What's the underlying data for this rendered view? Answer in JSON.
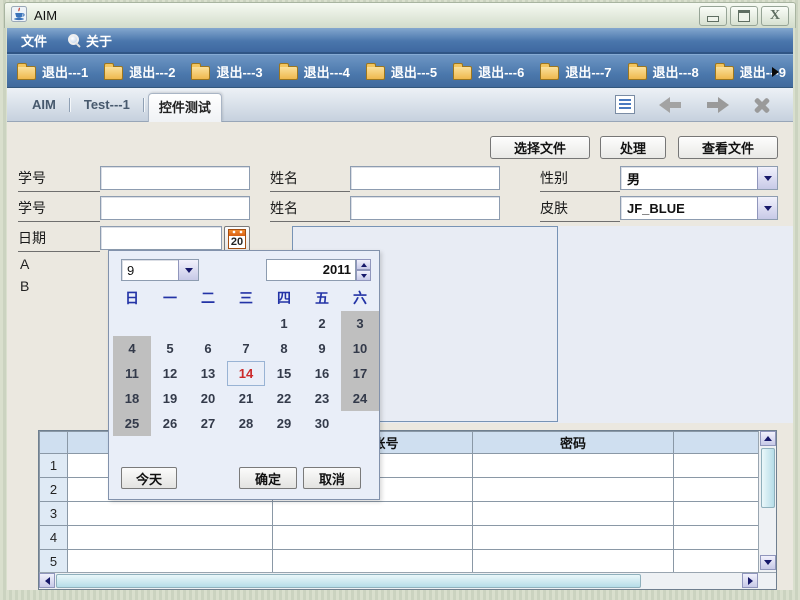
{
  "window": {
    "title": "AIM"
  },
  "menubar": {
    "file": "文件",
    "about": "关于"
  },
  "toolbar": {
    "items": [
      "退出---1",
      "退出---2",
      "退出---3",
      "退出---4",
      "退出---5",
      "退出---6",
      "退出---7",
      "退出---8",
      "退出---9"
    ]
  },
  "tabs": {
    "items": [
      "AIM",
      "Test---1",
      "控件测试"
    ],
    "selected": "控件测试"
  },
  "buttons": {
    "select_file": "选择文件",
    "process": "处理",
    "view_file": "查看文件"
  },
  "form": {
    "student_id_label": "学号",
    "name_label": "姓名",
    "gender_label": "性别",
    "gender_value": "男",
    "student_id2_label": "学号",
    "name2_label": "姓名",
    "skin_label": "皮肤",
    "skin_value": "JF_BLUE",
    "date_label": "日期",
    "date_value": "",
    "date_picker_day": "20",
    "label_a": "A",
    "label_b": "B"
  },
  "calendar": {
    "month": "9",
    "year": "2011",
    "weekdays": [
      "日",
      "一",
      "二",
      "三",
      "四",
      "五",
      "六"
    ],
    "weeks": [
      [
        "",
        "",
        "",
        "",
        "1",
        "2",
        "3"
      ],
      [
        "4",
        "5",
        "6",
        "7",
        "8",
        "9",
        "10"
      ],
      [
        "11",
        "12",
        "13",
        "14",
        "15",
        "16",
        "17"
      ],
      [
        "18",
        "19",
        "20",
        "21",
        "22",
        "23",
        "24"
      ],
      [
        "25",
        "26",
        "27",
        "28",
        "29",
        "30",
        ""
      ]
    ],
    "selected_day": "14",
    "today": "今天",
    "ok": "确定",
    "cancel": "取消"
  },
  "table": {
    "headers": {
      "col2": "账号",
      "col3": "密码"
    },
    "row_numbers": [
      "1",
      "2",
      "3",
      "4",
      "5"
    ]
  },
  "colors": {
    "menubar_blue": "#4a76ac",
    "selected_day_red": "#cc2a2a",
    "weekend_gray": "#bfbfbf",
    "table_header_blue": "#cfdff0"
  }
}
